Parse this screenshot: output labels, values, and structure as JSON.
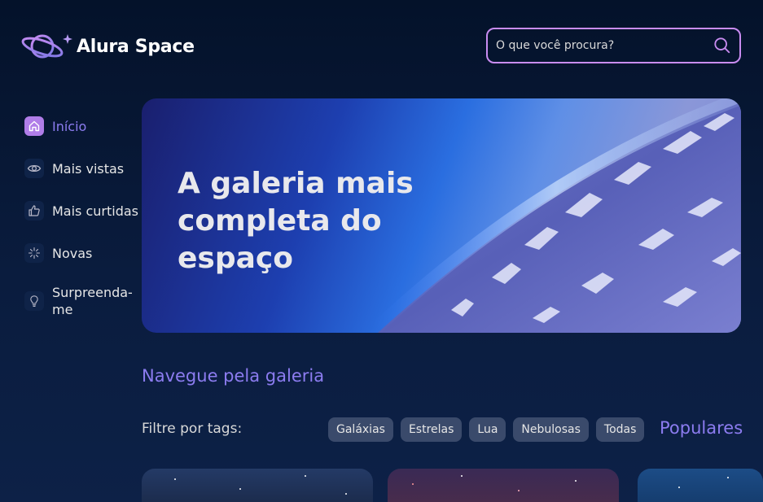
{
  "header": {
    "logo_text": "Alura Space",
    "search_placeholder": "O que você procura?"
  },
  "sidebar": {
    "items": [
      {
        "label": "Início",
        "icon": "home-icon",
        "active": true
      },
      {
        "label": "Mais vistas",
        "icon": "eye-icon",
        "active": false
      },
      {
        "label": "Mais curtidas",
        "icon": "thumbs-up-icon",
        "active": false
      },
      {
        "label": "Novas",
        "icon": "sparkle-icon",
        "active": false
      },
      {
        "label": "Surpreenda-me",
        "icon": "lightbulb-icon",
        "active": false
      }
    ]
  },
  "banner": {
    "title": "A galeria mais completa do espaço"
  },
  "gallery": {
    "section_title": "Navegue pela galeria",
    "filter_label": "Filtre por tags:",
    "tags": [
      "Galáxias",
      "Estrelas",
      "Lua",
      "Nebulosas",
      "Todas"
    ],
    "popular_title": "Populares"
  },
  "colors": {
    "background": "#04122a",
    "accent": "#8c7cf0",
    "search_border": "#c98cf1",
    "tag_background": "#3a4a6b"
  }
}
